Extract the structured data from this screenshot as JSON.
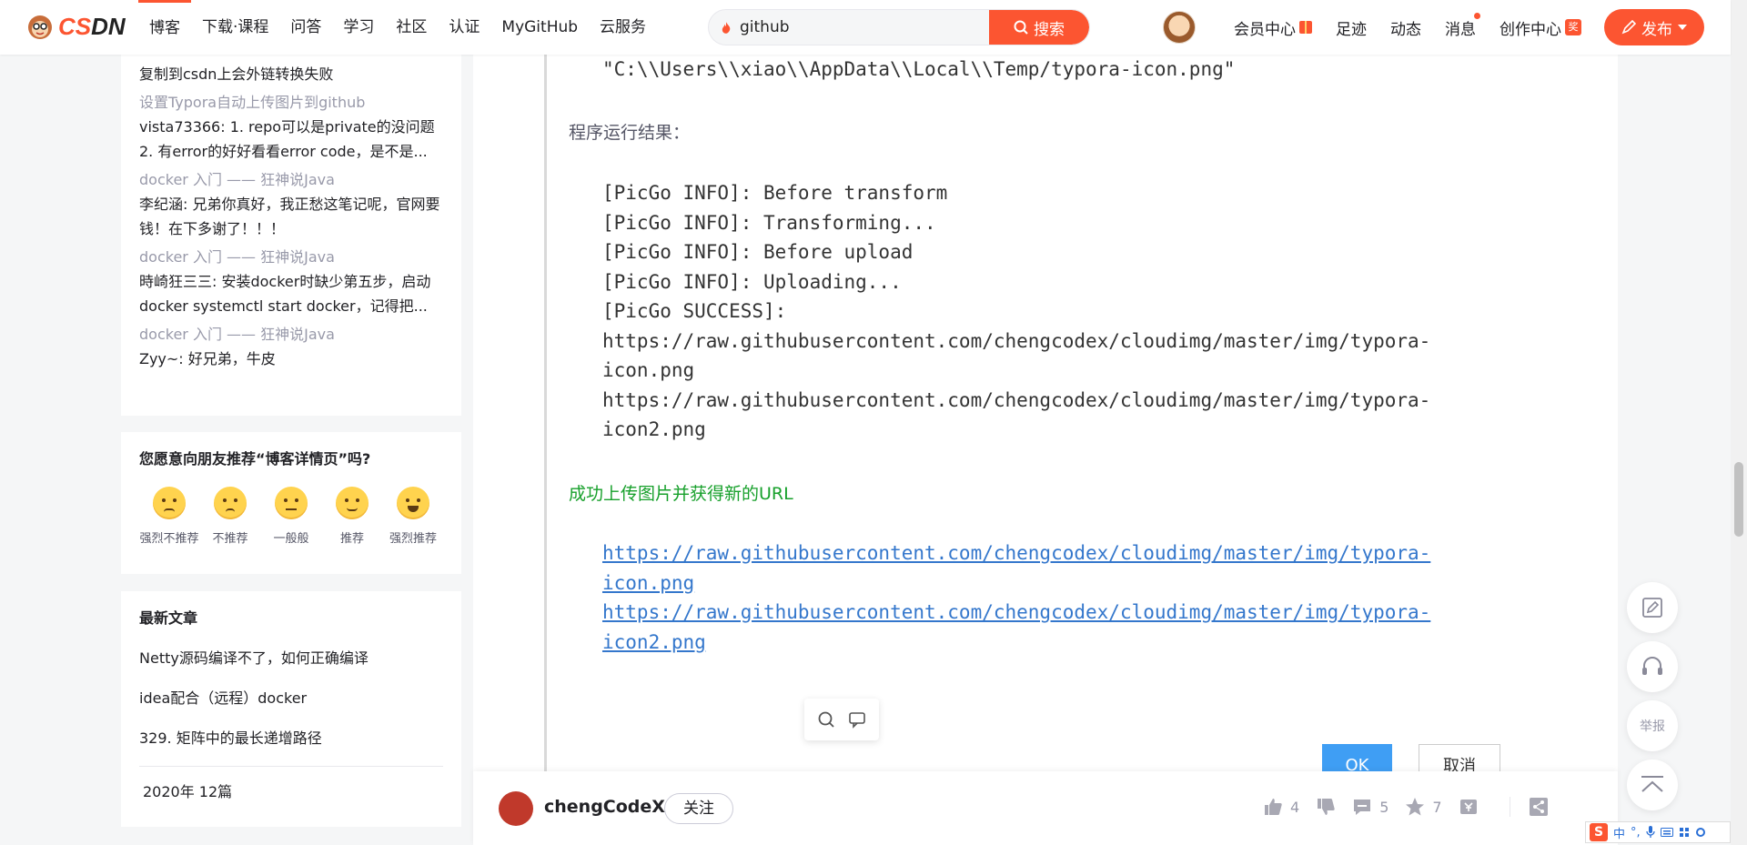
{
  "nav": {
    "logo_text_orange": "CS",
    "logo_text_dark": "DN",
    "items": [
      "博客",
      "下载·课程",
      "问答",
      "学习",
      "社区",
      "认证",
      "MyGitHub",
      "云服务"
    ],
    "search_value": "github",
    "search_button": "搜索",
    "right": {
      "vip": "会员中心",
      "footprint": "足迹",
      "dynamic": "动态",
      "messages": "消息",
      "creator": "创作中心",
      "creator_badge": "奖",
      "publish": "发布"
    },
    "accent": "#fc5531"
  },
  "sidebar": {
    "comments": [
      {
        "body": "复制到csdn上会外链转换失败"
      },
      {
        "title": "设置Typora自动上传图片到github",
        "body": "vista73366: 1. repo可以是private的没问题 2. 有error的好好看看error code，是不是..."
      },
      {
        "title": "docker 入门 —— 狂神说Java",
        "body": "李纪涵: 兄弟你真好，我正愁这笔记呢，官网要钱！在下多谢了！！！"
      },
      {
        "title": "docker 入门 —— 狂神说Java",
        "body": "時崎狂三三: 安装docker时缺少第五步，启动docker systemctl start docker，记得把..."
      },
      {
        "title": "docker 入门 —— 狂神说Java",
        "body": "Zyy~: 好兄弟，牛皮"
      }
    ],
    "recommend": {
      "question": "您愿意向朋友推荐“博客详情页”吗?",
      "options": [
        "强烈不推荐",
        "不推荐",
        "一般般",
        "推荐",
        "强烈推荐"
      ]
    },
    "latest": {
      "heading": "最新文章",
      "articles": [
        "Netty源码编译不了，如何正确编译",
        "idea配合（远程）docker",
        "329. 矩阵中的最长递增路径"
      ],
      "archive": "2020年  12篇"
    }
  },
  "article": {
    "path_line": "\"C:\\\\Users\\\\xiao\\\\AppData\\\\Local\\\\Temp/typora-icon.png\"",
    "result_label": "程序运行结果：",
    "log_lines": [
      "[PicGo INFO]: Before transform",
      "[PicGo INFO]: Transforming...",
      "[PicGo INFO]: Before upload",
      "[PicGo INFO]: Uploading...",
      "[PicGo SUCCESS]:",
      "https://raw.githubusercontent.com/chengcodex/cloudimg/master/img/typora-",
      "icon.png",
      "https://raw.githubusercontent.com/chengcodex/cloudimg/master/img/typora-",
      "icon2.png"
    ],
    "success_label": "成功上传图片并获得新的URL",
    "links": [
      "https://raw.githubusercontent.com/chengcodex/cloudimg/master/img/typora-",
      "icon.png",
      "https://raw.githubusercontent.com/chengcodex/cloudimg/master/img/typora-",
      "icon2.png"
    ],
    "ok_button": "OK",
    "cancel_button": "取消"
  },
  "bottom": {
    "author": "chengCodeX",
    "follow": "关注",
    "likes": "4",
    "comments": "5",
    "favorites": "7"
  },
  "side_tools": {
    "report": "举报"
  },
  "ime": {
    "lang": "中"
  }
}
